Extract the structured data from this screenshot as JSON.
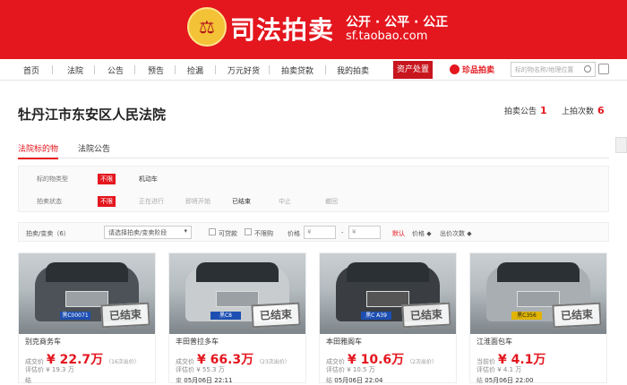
{
  "banner": {
    "emblem": "⚖",
    "title": "司法拍卖",
    "slogan": "公开 · 公平 · 公正",
    "domain": "sf.taobao.com",
    "accent": "#e4161e"
  },
  "nav": {
    "items": [
      "首页",
      "法院",
      "公告",
      "预告",
      "捡漏",
      "万元好货",
      "拍卖贷款",
      "我的拍卖"
    ],
    "asset": "资产处置",
    "zhenpin": "珍品拍卖",
    "search_placeholder": "标的物名称/地理位置"
  },
  "court": {
    "name": "牡丹江市东安区人民法院",
    "notice_label": "拍卖公告",
    "notice_count": "1",
    "times_label": "上拍次数",
    "times_count": "6"
  },
  "tabs": [
    "法院标的物",
    "法院公告"
  ],
  "filter": {
    "type_label": "标的物类型",
    "status_label": "拍卖状态",
    "unlimited": "不限",
    "type_options": [
      "机动车"
    ],
    "status_options": [
      "正在进行",
      "即将开始",
      "已结束",
      "中止",
      "撤回"
    ]
  },
  "sortbar": {
    "type": "拍卖/变卖（6）",
    "select": "请选择拍卖/变卖阶段",
    "loan": "可贷款",
    "no_limit": "不限购",
    "price": "价格",
    "currency": "¥",
    "dash": "-",
    "default": "默认",
    "price_sort": "价格",
    "bids_sort": "出价次数"
  },
  "cards": [
    {
      "name": "别克商务车",
      "deal_label": "成交价",
      "price": "22.7万",
      "bids": "（16次出价）",
      "eval_label": "评估价",
      "eval": "¥ 19.3 万",
      "end_label": "结",
      "time": "",
      "stamp": "已结束",
      "plate": "黑C00071"
    },
    {
      "name": "丰田普拉多车",
      "deal_label": "成交价",
      "price": "66.3万",
      "bids": "（23次出价）",
      "eval_label": "评估价",
      "eval": "¥ 55.3 万",
      "end_label": "束",
      "time": "05月06日 22:11",
      "stamp": "已结束",
      "plate": "黑C8"
    },
    {
      "name": "本田雅阁车",
      "deal_label": "成交价",
      "price": "10.6万",
      "bids": "（2次出价）",
      "eval_label": "评估价",
      "eval": "¥ 10.5 万",
      "end_label": "结",
      "time": "05月06日 22:04",
      "stamp": "已结束",
      "plate": "黑C A39"
    },
    {
      "name": "江淮面包车",
      "deal_label": "当前价",
      "price": "4.1万",
      "bids": "",
      "eval_label": "评估价",
      "eval": "¥ 4.1 万",
      "end_label": "结",
      "time": "05月06日 22:00",
      "stamp": "已结束",
      "plate": "黑C356"
    }
  ]
}
